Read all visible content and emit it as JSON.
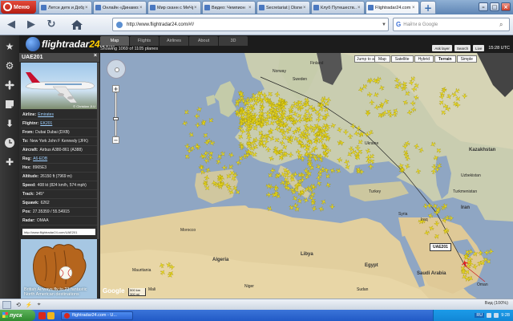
{
  "browser": {
    "menu_label": "Меню",
    "tabs": [
      {
        "title": "Летсе детк и Добр...",
        "active": false
      },
      {
        "title": "Онлайн «Динамо»...",
        "active": false
      },
      {
        "title": "Мир сканн с МеЧрН",
        "active": false
      },
      {
        "title": "Видео: Чемпион",
        "active": false
      },
      {
        "title": "Secretariat | Disney",
        "active": false
      },
      {
        "title": "Клуб Путешеств...",
        "active": false
      },
      {
        "title": "Flightradar24.com -...",
        "active": true
      }
    ],
    "add_tab": "+",
    "url": "http://www.flightradar24.com/#!/",
    "search_placeholder": "Найти в Google",
    "search_engine": "G"
  },
  "site": {
    "logo_main": "flightradar",
    "logo_accent": "24",
    "logo_suffix": ".com",
    "map_tabs": [
      {
        "label": "Map",
        "active": true
      },
      {
        "label": "Flights",
        "active": false
      },
      {
        "label": "Airlines",
        "active": false
      },
      {
        "label": "About",
        "active": false
      },
      {
        "label": "3D",
        "active": false
      }
    ],
    "showing": "Showing 1069 of 1105 planes",
    "top_buttons": [
      "Ask layer",
      "Search",
      "Live"
    ],
    "time": "15:28 UTC"
  },
  "flight": {
    "callsign": "UAE201",
    "photo_credit": "© Christian Jl.U",
    "rows": [
      {
        "k": "Airline:",
        "v": "Emirates",
        "link": true
      },
      {
        "k": "Flightnr:",
        "v": "EK201",
        "link": true
      },
      {
        "k": "From:",
        "v": "Dubai Dubai (DXB)",
        "link": false
      },
      {
        "k": "To:",
        "v": "New York John F Kennedy (JFK)",
        "link": false
      },
      {
        "k": "Aircraft:",
        "v": "Airbus A380-861 (A388)",
        "link": false
      },
      {
        "k": "Reg:",
        "v": "A6-EDB",
        "link": true
      },
      {
        "k": "Hex:",
        "v": "8965E3",
        "link": false
      },
      {
        "k": "Altitude:",
        "v": "26150 ft (7969 m)",
        "link": false
      },
      {
        "k": "Speed:",
        "v": "408 kt (824 km/h, 574 mph)",
        "link": false
      },
      {
        "k": "Track:",
        "v": "345°",
        "link": false
      },
      {
        "k": "Squawk:",
        "v": "6262",
        "link": false
      },
      {
        "k": "Pos:",
        "v": "27.35359 / 55.54915",
        "link": false
      },
      {
        "k": "Radar:",
        "v": "OMAA",
        "link": false
      }
    ],
    "permalink": "http://www.flightradar24.com/UAE201"
  },
  "ad": {
    "text": "British Airways fly to 23 fantastic North American destinations"
  },
  "map": {
    "jump_label": "Jump to area",
    "types": [
      {
        "label": "Map",
        "on": false
      },
      {
        "label": "Satellite",
        "on": false
      },
      {
        "label": "Hybrid",
        "on": false
      },
      {
        "label": "Terrain",
        "on": true
      },
      {
        "label": "Simple",
        "on": false
      }
    ],
    "callout": "UAE201",
    "google": "Google",
    "scale_km": "500 km",
    "scale_mi": "300 mi",
    "labels": [
      {
        "t": "Kazakhstan",
        "big": true
      },
      {
        "t": "Algeria",
        "big": true
      },
      {
        "t": "Egypt",
        "big": true
      },
      {
        "t": "Libya",
        "big": true
      },
      {
        "t": "Iran",
        "big": true
      },
      {
        "t": "Saudi Arabia",
        "big": true
      },
      {
        "t": "Mali",
        "big": false
      },
      {
        "t": "Niger",
        "big": false
      },
      {
        "t": "Mauritania",
        "big": false
      },
      {
        "t": "Morocco",
        "big": false
      },
      {
        "t": "Sudan",
        "big": false
      },
      {
        "t": "Oman",
        "big": false
      },
      {
        "t": "Turkey",
        "big": false
      },
      {
        "t": "Ukraine",
        "big": false
      },
      {
        "t": "Finland",
        "big": false
      },
      {
        "t": "Sweden",
        "big": false
      },
      {
        "t": "Norway",
        "big": false
      },
      {
        "t": "Iraq",
        "big": false
      },
      {
        "t": "Syria",
        "big": false
      },
      {
        "t": "Uzbekistan",
        "big": false
      },
      {
        "t": "Turkmenistan",
        "big": false
      }
    ]
  },
  "status": {
    "zoom": "Вид (100%)"
  },
  "taskbar": {
    "start": "пуск",
    "task": "flightradar24.com - U...",
    "lang": "RU",
    "clock": "9:28"
  }
}
